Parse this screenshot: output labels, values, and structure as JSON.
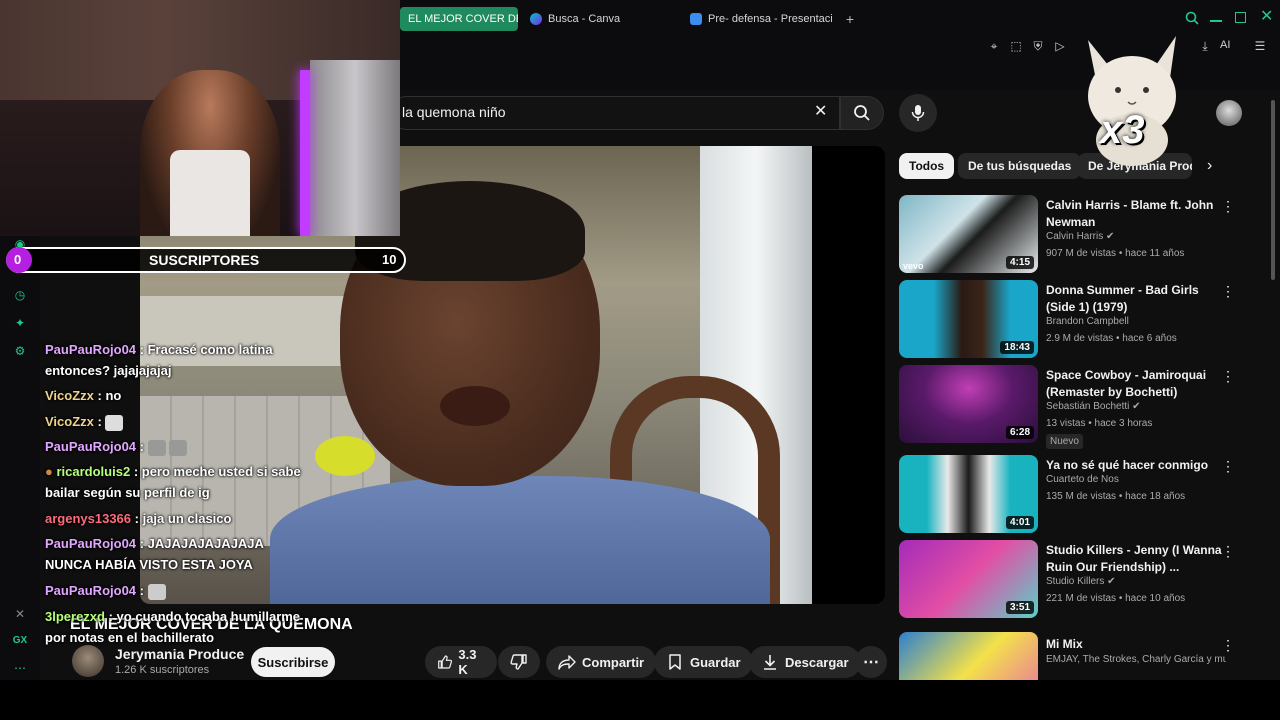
{
  "browser": {
    "tabs": [
      {
        "label": "EL MEJOR COVER DE",
        "active": true
      },
      {
        "label": "Busca - Canva",
        "active": false
      },
      {
        "label": "Pre- defensa - Presentació",
        "active": false
      }
    ],
    "new_tab_icon": "plus-icon",
    "ai_label": "AI"
  },
  "search": {
    "query": "la quemona niño"
  },
  "chips": [
    "Todos",
    "De tus búsquedas",
    "De Jerymania Produ"
  ],
  "video": {
    "title": "EL MEJOR COVER DE LA QUEMONA",
    "channel": "Jerymania Produce",
    "subscribers": "1.26 K suscriptores",
    "subscribe_label": "Suscribirse",
    "likes": "3.3 K",
    "share_label": "Compartir",
    "save_label": "Guardar",
    "download_label": "Descargar"
  },
  "recommendations": [
    {
      "title": "Calvin Harris - Blame ft. John Newman",
      "channel": "Calvin Harris",
      "verified": true,
      "meta": "907 M de vistas • hace 11 años",
      "duration": "4:15",
      "new": false,
      "thumb_colors": [
        "#7fb6c6",
        "#e8eef0"
      ],
      "thumb_label": "vevo"
    },
    {
      "title": "Donna Summer - Bad Girls (Side 1) (1979)",
      "channel": "Brandon Campbell",
      "verified": false,
      "meta": "2.9 M de vistas • hace 6 años",
      "duration": "18:43",
      "new": false,
      "thumb_colors": [
        "#1aa6c9",
        "#2a1a14"
      ]
    },
    {
      "title": "Space Cowboy - Jamiroquai (Remaster by Bochetti)",
      "channel": "Sebastián Bochetti",
      "verified": true,
      "meta": "13 vistas • hace 3 horas",
      "duration": "6:28",
      "new": true,
      "new_label": "Nuevo",
      "thumb_colors": [
        "#2a0f3a",
        "#c03fb5"
      ]
    },
    {
      "title": "Ya no sé qué hacer conmigo",
      "channel": "Cuarteto de Nos",
      "verified": false,
      "meta": "135 M de vistas • hace 18 años",
      "duration": "4:01",
      "new": false,
      "thumb_colors": [
        "#19b3c0",
        "#1b1b1b"
      ]
    },
    {
      "title": "Studio Killers - Jenny (I Wanna Ruin Our Friendship) ...",
      "channel": "Studio Killers",
      "verified": true,
      "meta": "221 M de vistas • hace 10 años",
      "duration": "3:51",
      "new": false,
      "thumb_colors": [
        "#a42bb8",
        "#e24fa5"
      ]
    },
    {
      "title": "Mi Mix",
      "channel": "EMJAY, The Strokes, Charly García y muc...",
      "verified": false,
      "meta": "",
      "duration": "",
      "new": false,
      "thumb_colors": [
        "#2d7fd0",
        "#f3e14a"
      ]
    }
  ],
  "subgoal": {
    "label": "SUSCRIPTORES",
    "min": "0",
    "max": "10",
    "progress": 0.02,
    "color": "#b41fe0"
  },
  "chat": [
    {
      "user": "PauPauRojo04",
      "color": "#e1a6ff",
      "text": ": Fracasé como latina",
      "cont": "entonces? jajajajajaj"
    },
    {
      "user": "VicoZzx",
      "color": "#f0d38c",
      "text": ": no"
    },
    {
      "user": "VicoZzx",
      "color": "#f0d38c",
      "text": ":"
    },
    {
      "user": "PauPauRojo04",
      "color": "#e1a6ff",
      "text": ":"
    },
    {
      "user": "ricardoluis2",
      "color": "#b6ff7a",
      "text": ": pero meche usted si sabe",
      "cont": "bailar según su perfil de ig"
    },
    {
      "user": "argenys13366",
      "color": "#ff6b7a",
      "text": ": jaja un clasico"
    },
    {
      "user": "PauPauRojo04",
      "color": "#e1a6ff",
      "text": ": JAJAJAJAJAJAJA",
      "cont": "NUNCA HABÍA VISTO ESTA JOYA"
    },
    {
      "user": "PauPauRojo04",
      "color": "#e1a6ff",
      "text": ":"
    },
    {
      "user": "3lperezxd",
      "color": "#b6ff7a",
      "text": ": yo cuando tocaba humillarme",
      "cont": "por notas en el bachillerato"
    }
  ],
  "sticker": {
    "text": "x3"
  }
}
